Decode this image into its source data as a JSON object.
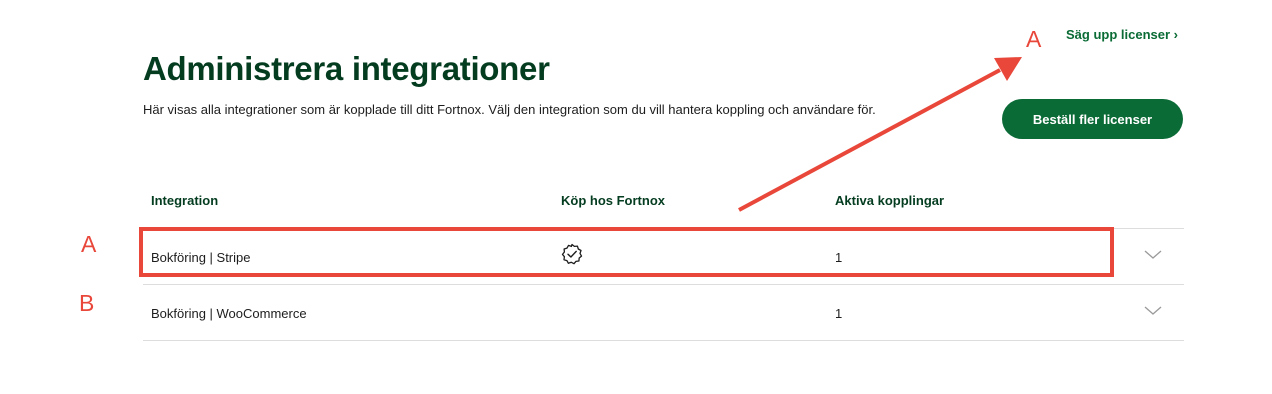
{
  "header": {
    "cancel_link": "Säg upp licenser ›",
    "title": "Administrera integrationer",
    "description": "Här visas alla integrationer som är kopplade till ditt Fortnox. Välj den integration som du vill hantera koppling och användare för.",
    "order_button": "Beställ fler licenser"
  },
  "table": {
    "headers": [
      "Integration",
      "Köp hos Fortnox",
      "Aktiva kopplingar"
    ],
    "rows": [
      {
        "integration": "Bokföring | Stripe",
        "bought_via_fortnox": true,
        "active": "1"
      },
      {
        "integration": "Bokföring | WooCommerce",
        "bought_via_fortnox": false,
        "active": "1"
      }
    ]
  },
  "annotations": {
    "marker_top": "A",
    "marker_row1": "A",
    "marker_row2": "B",
    "color": "#e8473a"
  },
  "colors": {
    "brand_green": "#0b6b37",
    "heading_green": "#043c20"
  },
  "icons": {
    "check": "verified-check-icon",
    "expand": "chevron-down-icon"
  }
}
